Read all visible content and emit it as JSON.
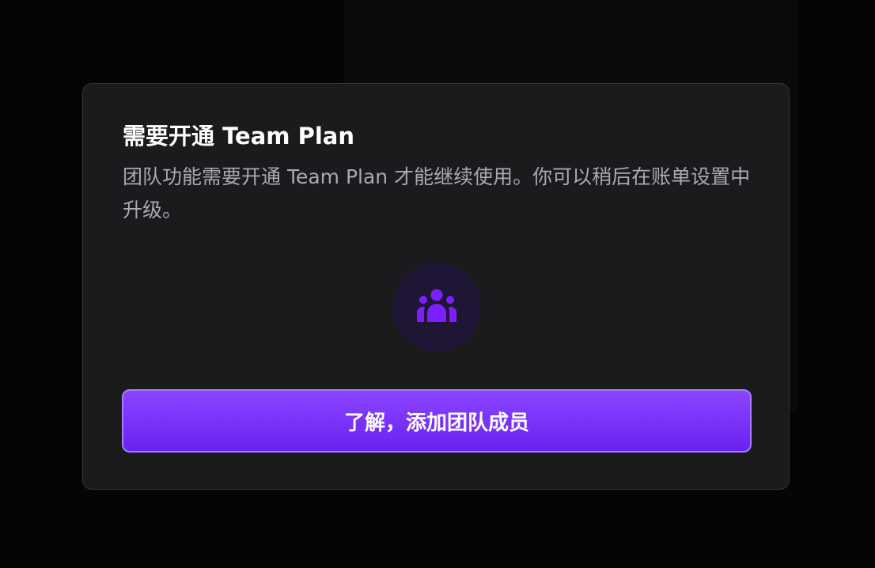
{
  "modal": {
    "title": "需要开通 Team Plan",
    "description": "团队功能需要开通 Team Plan 才能继续使用。你可以稍后在账单设置中升级。",
    "icon": "team-users-icon",
    "cta_label": "了解，添加团队成员"
  },
  "colors": {
    "accent": "#7c3aed",
    "modal_background": "#1b1b1e",
    "page_background": "#050505",
    "icon_circle": "#1f1636"
  }
}
